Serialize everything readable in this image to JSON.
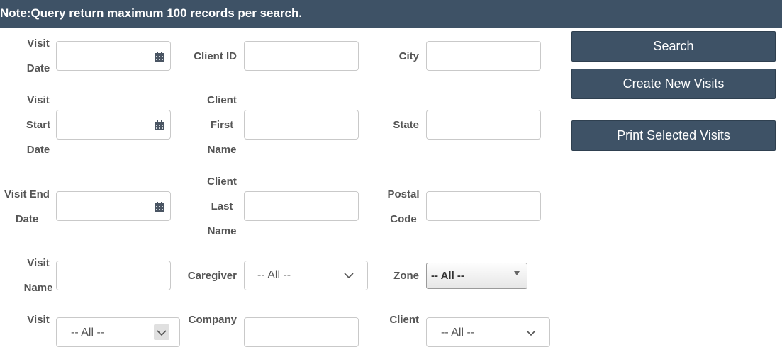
{
  "note": "Note:Query return maximum 100 records per search.",
  "fields": {
    "visit_date": [
      "Visit",
      "Date"
    ],
    "client_id": "Client ID",
    "city": "City",
    "visit_start_date": [
      "Visit",
      "Start",
      "Date"
    ],
    "client_first_name": [
      "Client",
      "First",
      "Name"
    ],
    "state": "State",
    "visit_end_date": [
      "Visit End",
      "Date"
    ],
    "client_last_name": [
      "Client",
      "Last",
      "Name"
    ],
    "postal_code": [
      "Postal",
      "Code"
    ],
    "visit_name": [
      "Visit",
      "Name"
    ],
    "caregiver": "Caregiver",
    "zone": "Zone",
    "visit_partial": "Visit",
    "company": "Company",
    "client_partial": "Client"
  },
  "selects": {
    "caregiver_value": "-- All --",
    "zone_value": "-- All --",
    "visit_value": "-- All --",
    "client_value": "-- All --"
  },
  "buttons": {
    "search": "Search",
    "create": "Create New Visits",
    "print": "Print Selected Visits"
  },
  "colors": {
    "header_bg": "#3e5266",
    "button_bg": "#3e5266",
    "label": "#555555"
  }
}
